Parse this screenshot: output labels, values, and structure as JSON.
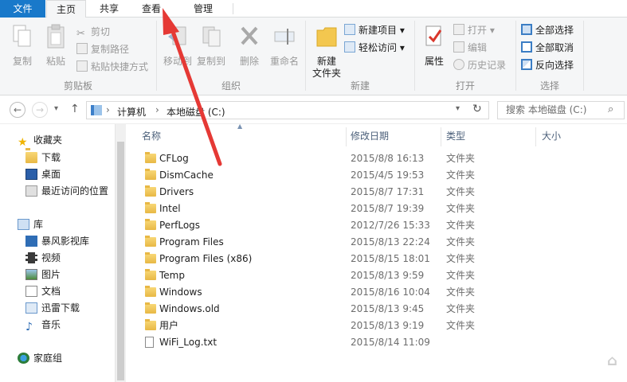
{
  "tabs": {
    "file": "文件",
    "home": "主页",
    "share": "共享",
    "view": "查看",
    "manage": "管理"
  },
  "ribbon": {
    "clipboard": {
      "copy": "复制",
      "paste": "粘贴",
      "cut": "剪切",
      "copy_path": "复制路径",
      "paste_shortcut": "粘贴快捷方式",
      "label": "剪贴板"
    },
    "organize": {
      "move_to": "移动到",
      "copy_to": "复制到",
      "delete": "删除",
      "rename": "重命名",
      "label": "组织"
    },
    "new": {
      "new_folder": "新建\n文件夹",
      "new_folder_l1": "新建",
      "new_folder_l2": "文件夹",
      "new_item": "新建项目",
      "easy_access": "轻松访问",
      "label": "新建"
    },
    "open": {
      "properties": "属性",
      "open": "打开",
      "edit": "编辑",
      "history": "历史记录",
      "label": "打开"
    },
    "select": {
      "select_all": "全部选择",
      "select_none": "全部取消",
      "invert": "反向选择",
      "label": "选择"
    }
  },
  "address": {
    "path": [
      "计算机",
      "本地磁盘 (C:)"
    ],
    "search_placeholder": "搜索 本地磁盘 (C:)"
  },
  "nav": {
    "favorites": "收藏夹",
    "downloads": "下载",
    "desktop": "桌面",
    "recent": "最近访问的位置",
    "libraries": "库",
    "baofeng": "暴风影视库",
    "videos": "视频",
    "pictures": "图片",
    "documents": "文档",
    "xunlei": "迅雷下载",
    "music": "音乐",
    "homegroup": "家庭组"
  },
  "columns": {
    "name": "名称",
    "date": "修改日期",
    "type": "类型",
    "size": "大小"
  },
  "files": [
    {
      "name": "CFLog",
      "date": "2015/8/8 16:13",
      "type": "文件夹"
    },
    {
      "name": "DismCache",
      "date": "2015/4/5 19:53",
      "type": "文件夹"
    },
    {
      "name": "Drivers",
      "date": "2015/8/7 17:31",
      "type": "文件夹"
    },
    {
      "name": "Intel",
      "date": "2015/8/7 19:39",
      "type": "文件夹"
    },
    {
      "name": "PerfLogs",
      "date": "2012/7/26 15:33",
      "type": "文件夹"
    },
    {
      "name": "Program Files",
      "date": "2015/8/13 22:24",
      "type": "文件夹"
    },
    {
      "name": "Program Files (x86)",
      "date": "2015/8/15 18:01",
      "type": "文件夹"
    },
    {
      "name": "Temp",
      "date": "2015/8/13 9:59",
      "type": "文件夹"
    },
    {
      "name": "Windows",
      "date": "2015/8/16 10:04",
      "type": "文件夹"
    },
    {
      "name": "Windows.old",
      "date": "2015/8/13 9:45",
      "type": "文件夹"
    },
    {
      "name": "用户",
      "date": "2015/8/13 9:19",
      "type": "文件夹"
    },
    {
      "name": "WiFi_Log.txt",
      "date": "2015/8/14 11:09",
      "type": ""
    }
  ],
  "colors": {
    "file_tab": "#1979ca",
    "annotation_arrow": "#e53935"
  }
}
